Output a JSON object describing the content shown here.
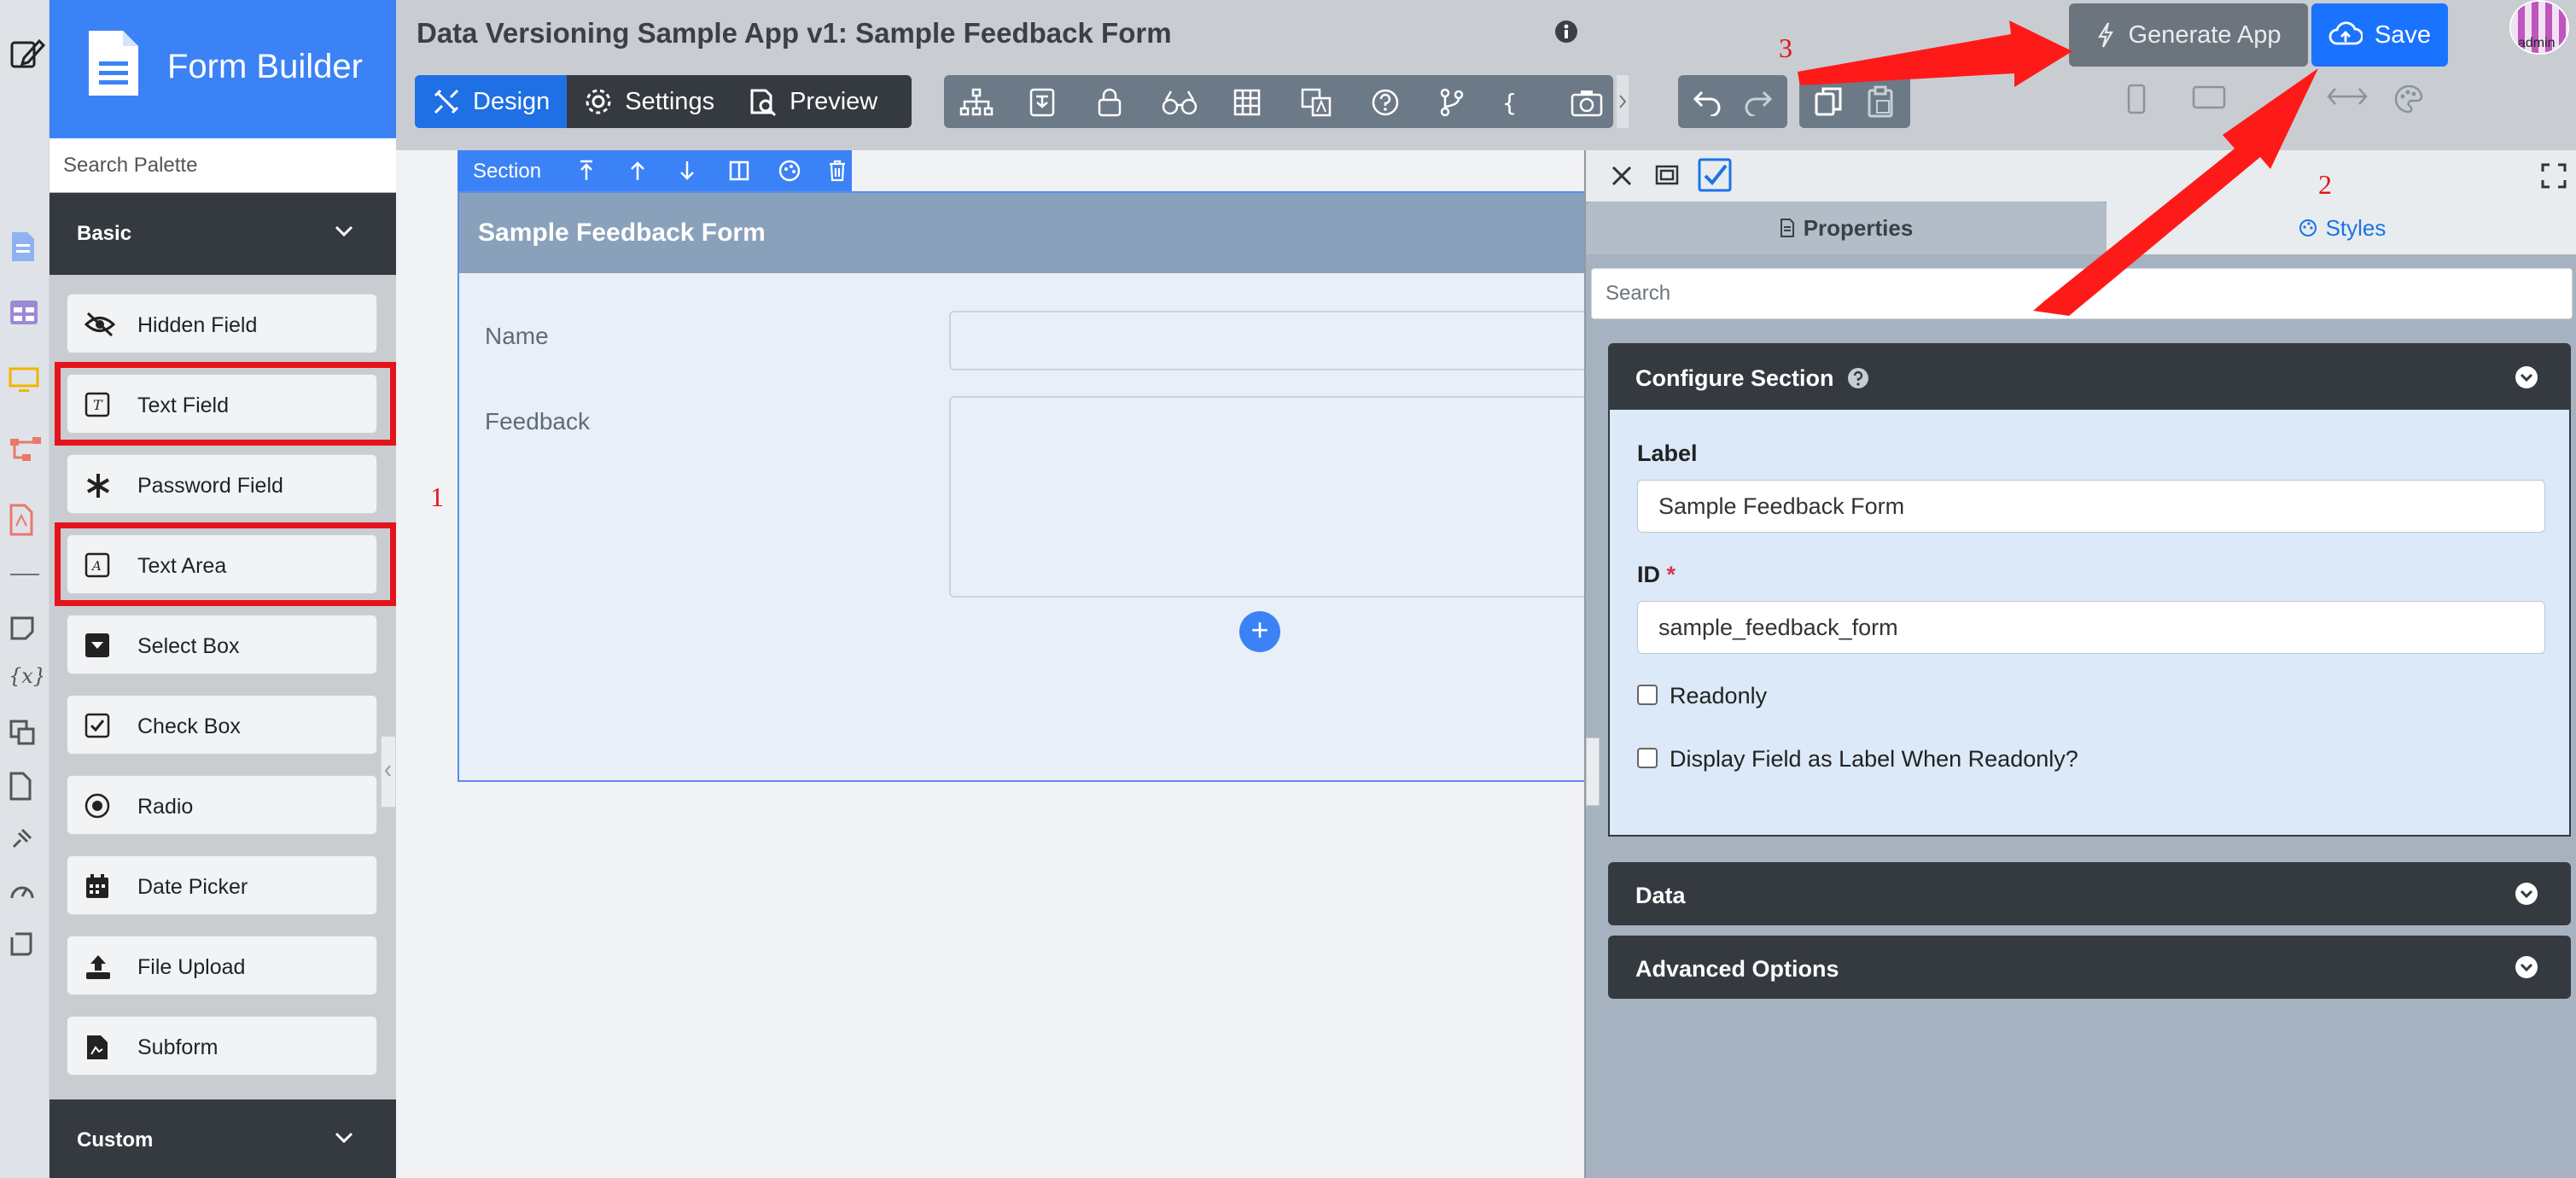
{
  "sidebar_icons": [
    "edit-icon",
    "document-icon",
    "table-icon",
    "monitor-icon",
    "hierarchy-icon",
    "pdf-icon",
    "note-icon",
    "variable-icon",
    "translate-icon",
    "file-icon",
    "plugin-icon",
    "dashboard-icon",
    "script-icon"
  ],
  "palette": {
    "title": "Form Builder",
    "search_placeholder": "Search Palette",
    "category_basic": "Basic",
    "category_custom": "Custom",
    "items": [
      {
        "label": "Hidden Field",
        "icon": "eye-slash-icon"
      },
      {
        "label": "Text Field",
        "icon": "text-field-icon"
      },
      {
        "label": "Password Field",
        "icon": "asterisk-icon"
      },
      {
        "label": "Text Area",
        "icon": "text-area-icon"
      },
      {
        "label": "Select Box",
        "icon": "select-box-icon"
      },
      {
        "label": "Check Box",
        "icon": "check-box-icon"
      },
      {
        "label": "Radio",
        "icon": "radio-icon"
      },
      {
        "label": "Date Picker",
        "icon": "calendar-icon"
      },
      {
        "label": "File Upload",
        "icon": "upload-icon"
      },
      {
        "label": "Subform",
        "icon": "subform-icon"
      }
    ]
  },
  "header": {
    "title": "Data Versioning Sample App v1: Sample Feedback Form",
    "modes": [
      "Design",
      "Settings",
      "Preview"
    ],
    "active_mode": "Design",
    "generate_label": "Generate App",
    "save_label": "Save",
    "avatar_text": "admin"
  },
  "canvas": {
    "section_toolbar_label": "Section",
    "section_title": "Sample Feedback Form",
    "fields": [
      {
        "label": "Name"
      },
      {
        "label": "Feedback"
      }
    ]
  },
  "properties": {
    "tab_properties": "Properties",
    "tab_styles": "Styles",
    "search_placeholder": "Search",
    "configure_title": "Configure Section",
    "label_field_label": "Label",
    "label_value": "Sample Feedback Form",
    "id_field_label": "ID",
    "required_mark": "*",
    "id_value": "sample_feedback_form",
    "readonly_label": "Readonly",
    "readonly_checked": false,
    "display_label_label": "Display Field as Label When Readonly?",
    "display_label_checked": false,
    "data_section": "Data",
    "advanced_section": "Advanced Options"
  },
  "annotations": {
    "marker_1": "1",
    "marker_2": "2",
    "marker_3": "3",
    "color": "#ff1a1a"
  }
}
